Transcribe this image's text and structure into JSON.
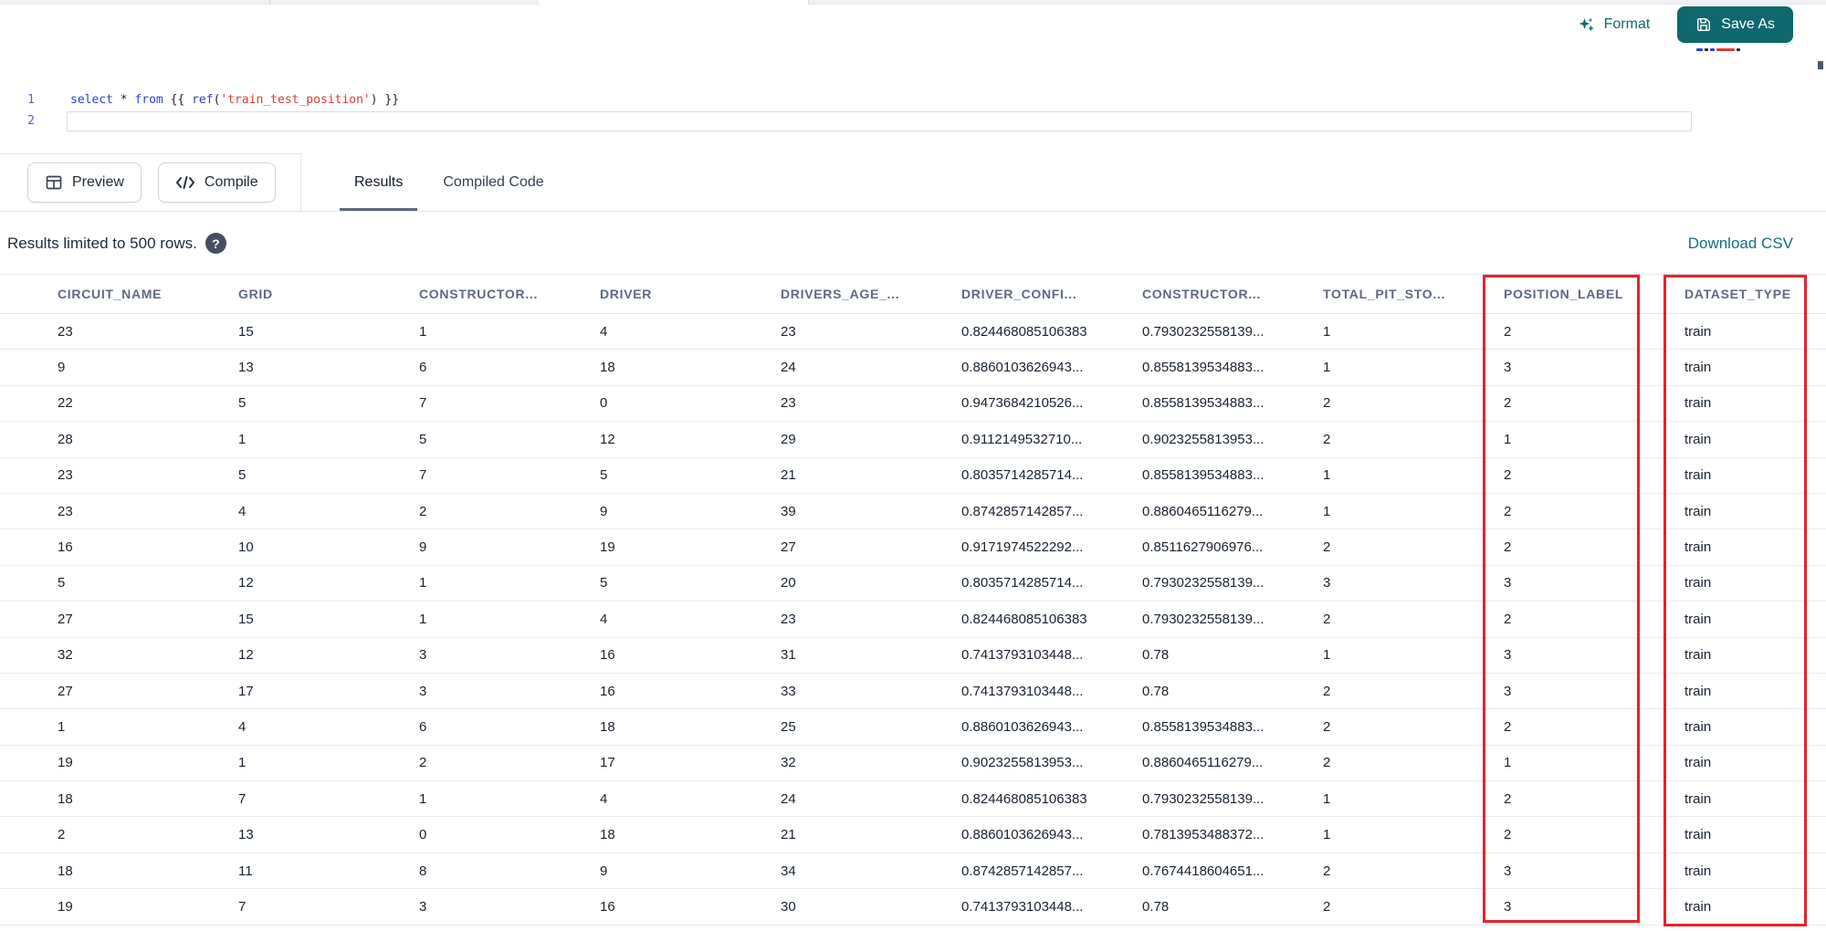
{
  "toolbar": {
    "format_label": "Format",
    "save_as_label": "Save As"
  },
  "editor": {
    "lines": [
      {
        "number": "1",
        "tokens": [
          {
            "text": "select",
            "type": "keyword"
          },
          {
            "text": " ",
            "type": "plain"
          },
          {
            "text": "*",
            "type": "operator"
          },
          {
            "text": " ",
            "type": "plain"
          },
          {
            "text": "from",
            "type": "keyword"
          },
          {
            "text": " {{ ",
            "type": "plain"
          },
          {
            "text": "ref",
            "type": "keyword"
          },
          {
            "text": "(",
            "type": "plain"
          },
          {
            "text": "'train_test_position'",
            "type": "string"
          },
          {
            "text": ")",
            "type": "plain"
          },
          {
            "text": " }}",
            "type": "plain"
          }
        ]
      },
      {
        "number": "2",
        "tokens": []
      }
    ]
  },
  "actions": {
    "preview_label": "Preview",
    "compile_label": "Compile"
  },
  "tabs": [
    {
      "label": "Results",
      "active": true
    },
    {
      "label": "Compiled Code",
      "active": false
    }
  ],
  "results_bar": {
    "info_text": "Results limited to 500 rows.",
    "help_glyph": "?",
    "download_label": "Download CSV"
  },
  "table": {
    "columns": [
      "CIRCUIT_NAME",
      "GRID",
      "CONSTRUCTOR...",
      "DRIVER",
      "DRIVERS_AGE_...",
      "DRIVER_CONFI...",
      "CONSTRUCTOR...",
      "TOTAL_PIT_STO...",
      "POSITION_LABEL",
      "DATASET_TYPE"
    ],
    "rows": [
      [
        "23",
        "15",
        "1",
        "4",
        "23",
        "0.824468085106383",
        "0.7930232558139...",
        "1",
        "2",
        "train"
      ],
      [
        "9",
        "13",
        "6",
        "18",
        "24",
        "0.8860103626943...",
        "0.8558139534883...",
        "1",
        "3",
        "train"
      ],
      [
        "22",
        "5",
        "7",
        "0",
        "23",
        "0.9473684210526...",
        "0.8558139534883...",
        "2",
        "2",
        "train"
      ],
      [
        "28",
        "1",
        "5",
        "12",
        "29",
        "0.9112149532710...",
        "0.9023255813953...",
        "2",
        "1",
        "train"
      ],
      [
        "23",
        "5",
        "7",
        "5",
        "21",
        "0.8035714285714...",
        "0.8558139534883...",
        "1",
        "2",
        "train"
      ],
      [
        "23",
        "4",
        "2",
        "9",
        "39",
        "0.8742857142857...",
        "0.8860465116279...",
        "1",
        "2",
        "train"
      ],
      [
        "16",
        "10",
        "9",
        "19",
        "27",
        "0.9171974522292...",
        "0.8511627906976...",
        "2",
        "2",
        "train"
      ],
      [
        "5",
        "12",
        "1",
        "5",
        "20",
        "0.8035714285714...",
        "0.7930232558139...",
        "3",
        "3",
        "train"
      ],
      [
        "27",
        "15",
        "1",
        "4",
        "23",
        "0.824468085106383",
        "0.7930232558139...",
        "2",
        "2",
        "train"
      ],
      [
        "32",
        "12",
        "3",
        "16",
        "31",
        "0.7413793103448...",
        "0.78",
        "1",
        "3",
        "train"
      ],
      [
        "27",
        "17",
        "3",
        "16",
        "33",
        "0.7413793103448...",
        "0.78",
        "2",
        "3",
        "train"
      ],
      [
        "1",
        "4",
        "6",
        "18",
        "25",
        "0.8860103626943...",
        "0.8558139534883...",
        "2",
        "2",
        "train"
      ],
      [
        "19",
        "1",
        "2",
        "17",
        "32",
        "0.9023255813953...",
        "0.8860465116279...",
        "2",
        "1",
        "train"
      ],
      [
        "18",
        "7",
        "1",
        "4",
        "24",
        "0.824468085106383",
        "0.7930232558139...",
        "1",
        "2",
        "train"
      ],
      [
        "2",
        "13",
        "0",
        "18",
        "21",
        "0.8860103626943...",
        "0.7813953488372...",
        "1",
        "2",
        "train"
      ],
      [
        "18",
        "11",
        "8",
        "9",
        "34",
        "0.8742857142857...",
        "0.7674418604651...",
        "2",
        "3",
        "train"
      ],
      [
        "19",
        "7",
        "3",
        "16",
        "30",
        "0.7413793103448...",
        "0.78",
        "2",
        "3",
        "train"
      ]
    ],
    "highlighted_columns": [
      "POSITION_LABEL",
      "DATASET_TYPE"
    ]
  },
  "colors": {
    "accent_teal": "#0F686D",
    "link_teal": "#116E7B",
    "highlight_red": "#EA2127",
    "keyword_blue": "#2742CC",
    "string_red": "#DC3B30"
  }
}
